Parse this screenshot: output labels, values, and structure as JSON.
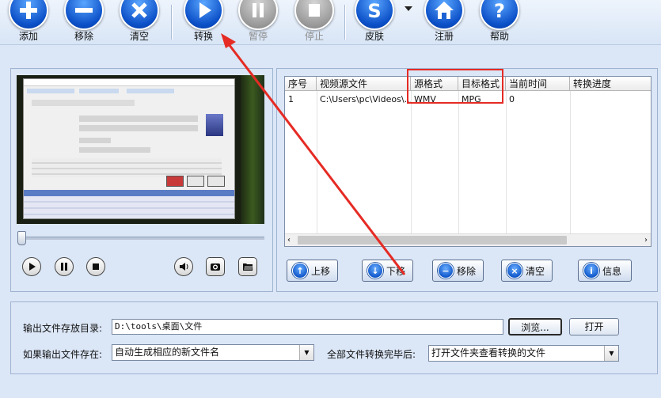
{
  "toolbar": {
    "buttons": [
      {
        "label": "添加",
        "icon": "plus-icon",
        "enabled": true
      },
      {
        "label": "移除",
        "icon": "minus-icon",
        "enabled": true
      },
      {
        "label": "清空",
        "icon": "x-icon",
        "enabled": true
      },
      {
        "label": "转换",
        "icon": "play-icon",
        "enabled": true
      },
      {
        "label": "暂停",
        "icon": "pause-icon",
        "enabled": false
      },
      {
        "label": "停止",
        "icon": "stop-icon",
        "enabled": false
      },
      {
        "label": "皮肤",
        "icon": "skin-icon",
        "enabled": true
      },
      {
        "label": "注册",
        "icon": "home-icon",
        "enabled": true
      },
      {
        "label": "帮助",
        "icon": "help-icon",
        "enabled": true
      }
    ]
  },
  "table": {
    "headers": [
      "序号",
      "视频源文件",
      "源格式",
      "目标格式",
      "当前时间",
      "转换进度"
    ],
    "rows": [
      {
        "index": "1",
        "source": "C:\\Users\\pc\\Videos\\...",
        "src_format": "WMV",
        "dst_format": "MPG",
        "time": "0",
        "progress": ""
      }
    ]
  },
  "list_buttons": {
    "up": "上移",
    "down": "下移",
    "remove": "移除",
    "clear": "清空",
    "info": "信息"
  },
  "output": {
    "dir_label": "输出文件存放目录:",
    "dir_value": "D:\\tools\\桌面\\文件",
    "browse": "浏览...",
    "open": "打开",
    "exists_label": "如果输出文件存在:",
    "exists_value": "自动生成相应的新文件名",
    "done_label": "全部文件转换完毕后:",
    "done_value": "打开文件夹查看转换的文件"
  },
  "colors": {
    "accent_blue": "#0b4fc7",
    "annotation_red": "#e52b24",
    "panel_bg": "#dbe6f6"
  }
}
